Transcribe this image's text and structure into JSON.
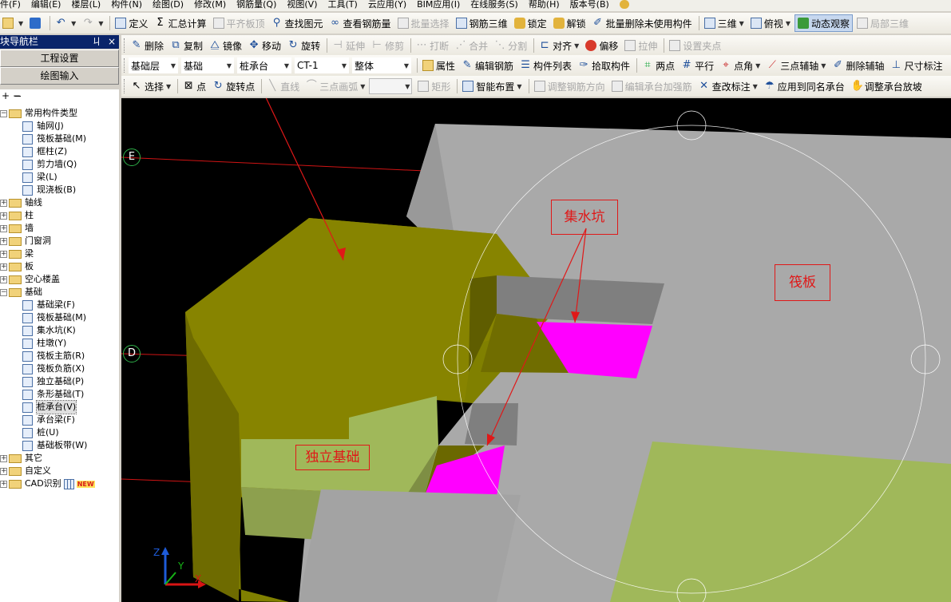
{
  "menu": [
    "件(F)",
    "编辑(E)",
    "楼层(L)",
    "构件(N)",
    "绘图(D)",
    "修改(M)",
    "钢筋量(Q)",
    "视图(V)",
    "工具(T)",
    "云应用(Y)",
    "BIM应用(I)",
    "在线服务(S)",
    "帮助(H)",
    "版本号(B)"
  ],
  "toolbar1": {
    "define": "定义",
    "sum_calc": "汇总计算",
    "flat_top": "平齐板顶",
    "find_element": "查找图元",
    "view_rebar": "查看钢筋量",
    "batch_select": "批量选择",
    "rebar_3d": "钢筋三维",
    "lock": "锁定",
    "unlock": "解锁",
    "batch_delete": "批量删除未使用构件",
    "three_d": "三维",
    "top_view": "俯视",
    "dynamic_observe": "动态观察",
    "partial_3d": "局部三维"
  },
  "toolbar2": {
    "delete": "删除",
    "copy": "复制",
    "mirror": "镜像",
    "move": "移动",
    "rotate": "旋转",
    "extend": "延伸",
    "trim": "修剪",
    "break": "打断",
    "merge": "合并",
    "split": "分割",
    "align": "对齐",
    "offset": "偏移",
    "stretch": "拉伸",
    "set_grip": "设置夹点"
  },
  "toolbar3": {
    "floor": "基础层",
    "category": "基础",
    "element_type": "桩承台",
    "element_name": "CT-1",
    "part": "整体",
    "properties": "属性",
    "edit_rebar": "编辑钢筋",
    "element_list": "构件列表",
    "pick_element": "拾取构件",
    "two_points": "两点",
    "parallel": "平行",
    "point_angle": "点角",
    "three_point_aux": "三点辅轴",
    "delete_aux": "删除辅轴",
    "dimension": "尺寸标注"
  },
  "toolbar4": {
    "select": "选择",
    "point": "点",
    "rotate_point": "旋转点",
    "line": "直线",
    "three_point_arc": "三点画弧",
    "rectangle": "矩形",
    "smart_layout": "智能布置",
    "adjust_rebar_dir": "调整钢筋方向",
    "edit_cap_rebar": "编辑承台加强筋",
    "check_annotation": "查改标注",
    "apply_same_cap": "应用到同名承台",
    "adjust_cap_slope": "调整承台放坡"
  },
  "nav": {
    "title": "块导航栏",
    "pin": "ㄐ",
    "close": "×",
    "project_settings": "工程设置",
    "drawing_input": "绘图输入"
  },
  "tree": {
    "common_types": "常用构件类型",
    "common_items": [
      "轴网(J)",
      "筏板基础(M)",
      "框柱(Z)",
      "剪力墙(Q)",
      "梁(L)",
      "现浇板(B)"
    ],
    "groups": [
      "轴线",
      "柱",
      "墙",
      "门窗洞",
      "梁",
      "板",
      "空心楼盖",
      "基础"
    ],
    "foundation_items": [
      "基础梁(F)",
      "筏板基础(M)",
      "集水坑(K)",
      "柱墩(Y)",
      "筏板主筋(R)",
      "筏板负筋(X)",
      "独立基础(P)",
      "条形基础(T)",
      "桩承台(V)",
      "承台梁(F)",
      "桩(U)",
      "基础板带(W)"
    ],
    "tail_groups": [
      "其它",
      "自定义",
      "CAD识别"
    ],
    "new_badge": "NEW"
  },
  "viewport": {
    "axis_e": "E",
    "axis_d": "D",
    "label_sump": "集水坑",
    "label_raft": "筏板",
    "label_isolated": "独立基础",
    "coord_x": "X",
    "coord_y": "Y",
    "coord_z": "Z"
  },
  "colors": {
    "olive": "#808000",
    "magenta": "#ff00ff",
    "gray_slab": "#a8a8a8",
    "light_green": "#a0b85a",
    "annotation_red": "#e01818"
  }
}
